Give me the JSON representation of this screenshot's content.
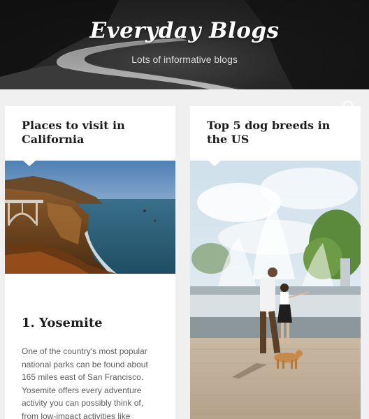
{
  "header": {
    "title": "Everyday Blogs",
    "tagline": "Lots of informative blogs"
  },
  "cards": [
    {
      "title": "Places to visit in California",
      "image": "coastal cliffs with arched bridge",
      "post_heading": "1. Yosemite",
      "post_body": "One of the country's most popular national parks can be found about 165 miles east of San Francisco. Yosemite offers every adventure activity you can possibly think of, from low-impact activities like"
    },
    {
      "title": "Top 5 dog breeds in the US",
      "image": "people walking a dog by a fountain"
    }
  ],
  "colors": {
    "page_background": "#f0f0f0",
    "card_background": "#ffffff",
    "title_text": "#1c1c1c",
    "body_text": "#5d5d5d"
  }
}
